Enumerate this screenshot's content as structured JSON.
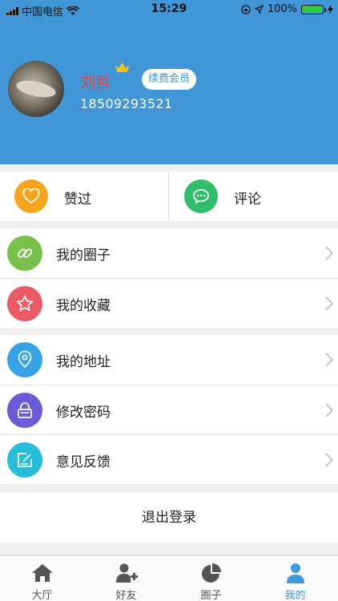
{
  "status_bar": {
    "carrier": "中国电信",
    "time": "15:29",
    "battery": "100%"
  },
  "profile": {
    "name": "刘哲",
    "renew_label": "续费会员",
    "phone": "18509293521"
  },
  "actions": [
    {
      "label": "赞过",
      "icon": "heart-icon",
      "color": "#f5a41d"
    },
    {
      "label": "评论",
      "icon": "chat-bubble-icon",
      "color": "#2fbe6a"
    }
  ],
  "menu_group_1": [
    {
      "label": "我的圈子",
      "icon": "link-icon",
      "color": "#79c24a"
    },
    {
      "label": "我的收藏",
      "icon": "star-icon",
      "color": "#ec5a66"
    }
  ],
  "menu_group_2": [
    {
      "label": "我的地址",
      "icon": "location-pin-icon",
      "color": "#35a3e6"
    },
    {
      "label": "修改密码",
      "icon": "lock-icon",
      "color": "#6a5bd6"
    },
    {
      "label": "意见反馈",
      "icon": "feedback-edit-icon",
      "color": "#27bddb"
    }
  ],
  "logout_label": "退出登录",
  "tabs": [
    {
      "label": "大厅",
      "icon": "home-icon"
    },
    {
      "label": "好友",
      "icon": "add-friend-icon"
    },
    {
      "label": "圈子",
      "icon": "pie-chart-icon"
    },
    {
      "label": "我的",
      "icon": "person-icon",
      "active": true
    }
  ],
  "colors": {
    "header_bg": "#4096d6",
    "accent": "#3b9bdc",
    "username": "#d84a4a",
    "crown": "#f2c318"
  }
}
